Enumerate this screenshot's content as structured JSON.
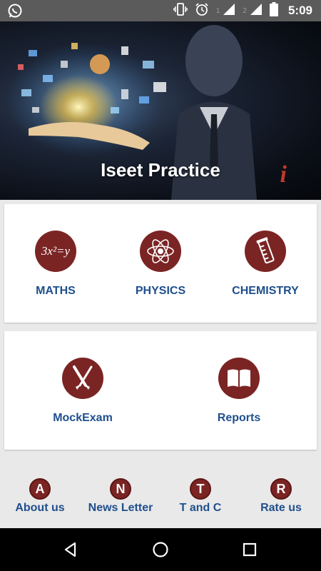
{
  "status_bar": {
    "time": "5:09",
    "sim1": "1",
    "sim2": "2",
    "icons": [
      "whatsapp-icon",
      "vibrate-icon",
      "alarm-icon",
      "signal-icon",
      "battery-icon"
    ]
  },
  "header": {
    "title": "Iseet Practice",
    "info_label": "i"
  },
  "subjects": [
    {
      "label": "MATHS",
      "icon": "equation-icon",
      "icon_text": "3x²=y"
    },
    {
      "label": "PHYSICS",
      "icon": "atom-icon"
    },
    {
      "label": "CHEMISTRY",
      "icon": "test-tube-icon"
    }
  ],
  "tools": [
    {
      "label": "MockExam",
      "icon": "brushes-icon"
    },
    {
      "label": "Reports",
      "icon": "book-icon"
    }
  ],
  "links": [
    {
      "label": "About us",
      "letter": "A"
    },
    {
      "label": "News Letter",
      "letter": "N"
    },
    {
      "label": "T and C",
      "letter": "T"
    },
    {
      "label": "Rate us",
      "letter": "R"
    }
  ],
  "colors": {
    "accent": "#7b2424",
    "label": "#1f4f8c",
    "status_bar": "#5b5b5b",
    "background": "#e9e9e9"
  }
}
